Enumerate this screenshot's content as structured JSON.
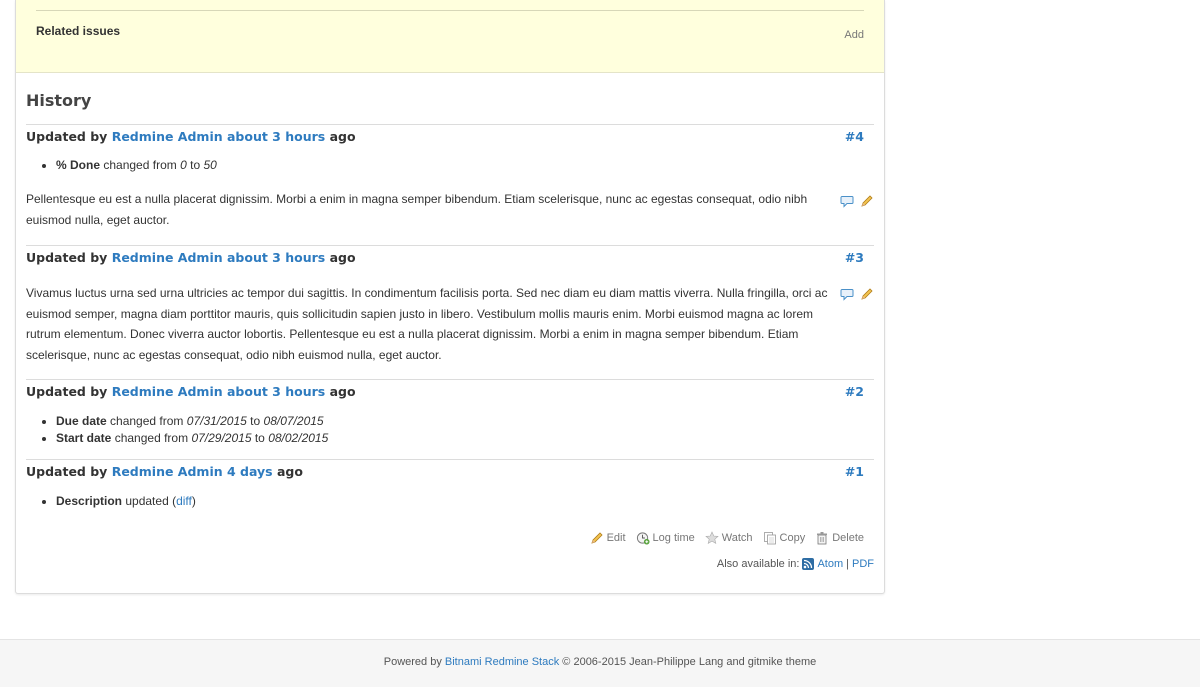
{
  "related": {
    "title": "Related issues",
    "add_label": "Add"
  },
  "history": {
    "title": "History"
  },
  "journals": [
    {
      "prefix": "Updated by",
      "author": "Redmine Admin",
      "time": "about 3 hours",
      "suffix": "ago",
      "number": "#4",
      "details": [
        {
          "field": "% Done",
          "text": "changed from",
          "from": "0",
          "to_word": "to",
          "to": "50"
        }
      ],
      "notes": "Pellentesque eu est a nulla placerat dignissim. Morbi a enim in magna semper bibendum. Etiam scelerisque, nunc ac egestas consequat, odio nibh euismod nulla, eget auctor."
    },
    {
      "prefix": "Updated by",
      "author": "Redmine Admin",
      "time": "about 3 hours",
      "suffix": "ago",
      "number": "#3",
      "notes": "Vivamus luctus urna sed urna ultricies ac tempor dui sagittis. In condimentum facilisis porta. Sed nec diam eu diam mattis viverra. Nulla fringilla, orci ac euismod semper, magna diam porttitor mauris, quis sollicitudin sapien justo in libero. Vestibulum mollis mauris enim. Morbi euismod magna ac lorem rutrum elementum. Donec viverra auctor lobortis. Pellentesque eu est a nulla placerat dignissim. Morbi a enim in magna semper bibendum. Etiam scelerisque, nunc ac egestas consequat, odio nibh euismod nulla, eget auctor."
    },
    {
      "prefix": "Updated by",
      "author": "Redmine Admin",
      "time": "about 3 hours",
      "suffix": "ago",
      "number": "#2",
      "details": [
        {
          "field": "Due date",
          "text": "changed from",
          "from": "07/31/2015",
          "to_word": "to",
          "to": "08/07/2015"
        },
        {
          "field": "Start date",
          "text": "changed from",
          "from": "07/29/2015",
          "to_word": "to",
          "to": "08/02/2015"
        }
      ]
    },
    {
      "prefix": "Updated by",
      "author": "Redmine Admin",
      "time": "4 days",
      "suffix": "ago",
      "number": "#1",
      "details": [
        {
          "field": "Description",
          "text": "updated (",
          "link": "diff",
          "close": ")"
        }
      ]
    }
  ],
  "actions": {
    "edit": "Edit",
    "log_time": "Log time",
    "watch": "Watch",
    "copy": "Copy",
    "delete": "Delete"
  },
  "other_formats": {
    "label": "Also available in:",
    "atom": "Atom",
    "sep": "|",
    "pdf": "PDF"
  },
  "footer": {
    "powered_by": "Powered by",
    "link": "Bitnami Redmine Stack",
    "rest": "© 2006-2015 Jean-Philippe Lang and gitmike theme"
  },
  "icons": {
    "comment": "comment-icon",
    "edit": "pencil-icon",
    "log_time": "clock-add-icon",
    "watch": "star-icon",
    "copy": "copy-icon",
    "delete": "trash-icon",
    "feed": "rss-feed-icon"
  },
  "colors": {
    "link": "#2e7bbf",
    "related_bg": "#ffffdd",
    "footer_bg": "#f6f6f6"
  }
}
